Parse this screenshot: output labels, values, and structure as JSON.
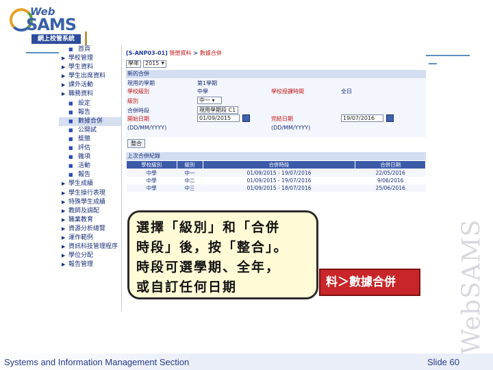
{
  "logo": {
    "web": "Web",
    "sams": "SAMS",
    "subtitle": "網上校管系統"
  },
  "vertical_brand": "WebSAMS",
  "nav": {
    "items": [
      {
        "label": "首頁",
        "sub": true
      },
      {
        "label": "學校管理",
        "sub": false
      },
      {
        "label": "學生資料",
        "sub": false
      },
      {
        "label": "學生出席資料",
        "sub": false
      },
      {
        "label": "課外活動",
        "sub": false
      },
      {
        "label": "職務資料",
        "sub": false
      },
      {
        "label": "設定",
        "sub": true
      },
      {
        "label": "報告",
        "sub": true
      },
      {
        "label": "數據合併",
        "sub": true,
        "selected": true
      },
      {
        "label": "公開試",
        "sub": true
      },
      {
        "label": "獎懲",
        "sub": true
      },
      {
        "label": "評估",
        "sub": true
      },
      {
        "label": "雜項",
        "sub": true
      },
      {
        "label": "活動",
        "sub": true
      },
      {
        "label": "報告",
        "sub": true
      },
      {
        "label": "學生成績",
        "sub": false
      },
      {
        "label": "學生操行表現",
        "sub": false
      },
      {
        "label": "特殊學生成績",
        "sub": false
      },
      {
        "label": "教師及調配",
        "sub": false
      },
      {
        "label": "職業教育",
        "sub": false
      },
      {
        "label": "資源分析總覽",
        "sub": false
      },
      {
        "label": "運作範例",
        "sub": false
      },
      {
        "label": "資訊科技管理程序",
        "sub": false
      },
      {
        "label": "學位分配",
        "sub": false
      },
      {
        "label": "報告管理",
        "sub": false
      }
    ]
  },
  "main": {
    "crumb_code": "[S-ANP03-01]",
    "crumb_link": "獎懲資料",
    "crumb_sep": ">",
    "crumb_current": "數據合併",
    "year_label": "學年",
    "year_value": "2015",
    "section_title": "新的合併",
    "form": {
      "current_term_label": "現用的學期",
      "current_term_value": "第1學期",
      "school_level_label": "學校級別",
      "school_level_value": "中學",
      "school_session_label": "學校授課時間",
      "school_session_value": "全日",
      "class_level_label": "級別",
      "class_level_value": "中一",
      "merge_period_label": "合併時段",
      "merge_period_value": "現用學期段",
      "merge_period_extra": "C1",
      "start_date_label": "開始日期",
      "start_date_value": "01/09/2015",
      "end_date_label": "完結日期",
      "end_date_value": "19/07/2016",
      "date_format_left": "(DD/MM/YYYY)",
      "date_format_right": "(DD/MM/YYYY)"
    },
    "merge_button": "整合",
    "table_title": "上次合併紀錄",
    "table_headers": [
      "學校級別",
      "級別",
      "合併時段",
      "合併日期"
    ],
    "table_rows": [
      [
        "中學",
        "中一",
        "01/09/2015 - 19/07/2016",
        "22/05/2016"
      ],
      [
        "中學",
        "中二",
        "01/09/2015 - 19/07/2016",
        "9/06/2016"
      ],
      [
        "中學",
        "中三",
        "01/09/2015 - 18/07/2016",
        "25/06/2016"
      ]
    ]
  },
  "callout": {
    "line1": "選擇「級別」和「合併",
    "line2": "時段」後，按「整合」。",
    "line3": "時段可選學期、全年，",
    "line4": "或自訂任何日期"
  },
  "path_label": "料＞數據合併",
  "footer": {
    "left": "Systems and Information Management Section",
    "right": "Slide 60"
  }
}
